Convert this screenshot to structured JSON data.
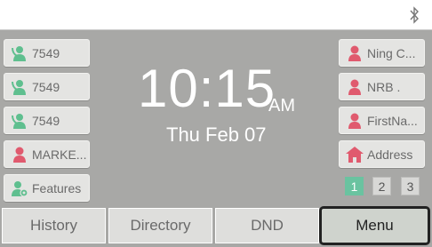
{
  "status_bar": {
    "bluetooth_icon": "bluetooth-icon"
  },
  "left_keys": [
    {
      "label": "7549",
      "icon": "line-idle-icon",
      "color": "#5fbf8f"
    },
    {
      "label": "7549",
      "icon": "line-idle-icon",
      "color": "#5fbf8f"
    },
    {
      "label": "7549",
      "icon": "line-idle-icon",
      "color": "#5fbf8f"
    },
    {
      "label": "MARKE...",
      "icon": "contact-icon",
      "color": "#e05a6e"
    },
    {
      "label": "Features",
      "icon": "features-icon",
      "color": "#5fbf8f"
    }
  ],
  "right_keys": [
    {
      "label": "Ning C...",
      "icon": "contact-icon",
      "color": "#e05a6e"
    },
    {
      "label": "NRB .",
      "icon": "contact-icon",
      "color": "#e05a6e"
    },
    {
      "label": "FirstNa...",
      "icon": "contact-icon",
      "color": "#e05a6e"
    },
    {
      "label": "Address",
      "icon": "address-book-icon",
      "color": "#e05a6e"
    }
  ],
  "clock": {
    "time": "10:15",
    "ampm": "AM",
    "date": "Thu Feb 07"
  },
  "pages": {
    "items": [
      "1",
      "2",
      "3"
    ],
    "active": "1"
  },
  "softkeys": [
    {
      "label": "History",
      "selected": false
    },
    {
      "label": "Directory",
      "selected": false
    },
    {
      "label": "DND",
      "selected": false
    },
    {
      "label": "Menu",
      "selected": true
    }
  ],
  "colors": {
    "background": "#a8a8a6",
    "accent": "#6ac3a0",
    "contact": "#e05a6e",
    "line": "#5fbf8f"
  }
}
